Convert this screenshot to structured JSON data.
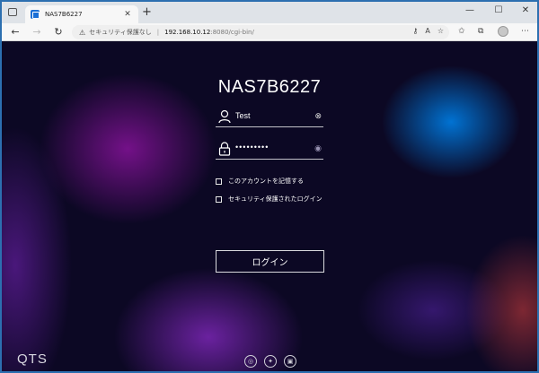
{
  "browser": {
    "tab": {
      "title": "NAS7B6227",
      "close": "✕"
    },
    "new_tab": "+",
    "window_controls": {
      "minimize": "—",
      "maximize": "☐",
      "close": "✕"
    },
    "nav": {
      "back": "←",
      "forward": "→",
      "reload": "↻"
    },
    "address_bar": {
      "security_label": "セキュリティ保護なし",
      "url_host": "192.168.10.12",
      "url_rest": ":8080/cgi-bin/"
    },
    "icons": [
      "key-icon",
      "read-aloud-icon",
      "favorite-icon",
      "favorites-bar-icon",
      "collections-icon",
      "profile-icon"
    ]
  },
  "login": {
    "device_name": "NAS7B6227",
    "username": "Test",
    "password_masked": "•••••••••",
    "remember_account_label": "このアカウントを記憶する",
    "secure_login_label": "セキュリティ保護されたログイン",
    "login_button": "ログイン"
  },
  "footer": {
    "logo": "QTS",
    "icons": [
      "mobile-app-icon",
      "utility-icon",
      "portal-icon"
    ]
  },
  "colors": {
    "page_background": "#0c0824",
    "accent_blue": "#0078dc",
    "accent_purple": "#9614aa",
    "text": "#ffffff"
  }
}
